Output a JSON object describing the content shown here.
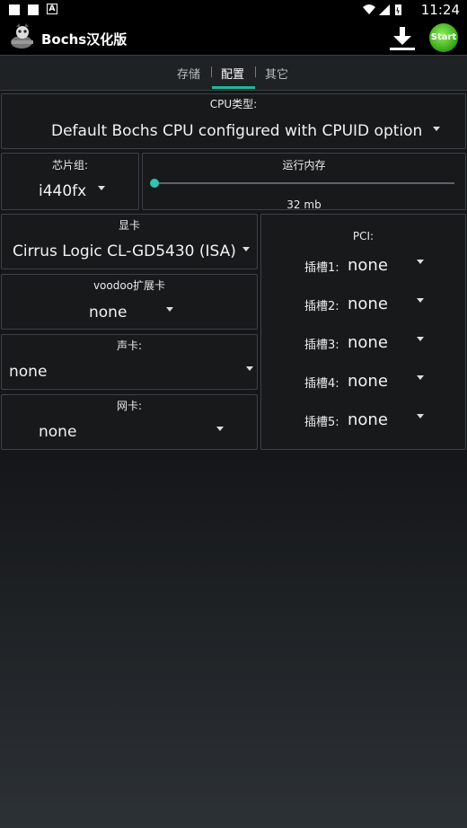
{
  "status_bar": {
    "time": "11:24"
  },
  "app": {
    "title": "Bochs汉化版",
    "start_label": "Start"
  },
  "tabs": [
    {
      "label": "存储"
    },
    {
      "label": "配置"
    },
    {
      "label": "其它"
    }
  ],
  "cpu": {
    "label": "CPU类型:",
    "value": "Default Bochs CPU configured with CPUID option"
  },
  "chipset": {
    "label": "芯片组:",
    "value": "i440fx"
  },
  "memory": {
    "label": "运行内存",
    "value": "32 mb"
  },
  "video": {
    "label": "显卡",
    "value": "Cirrus Logic CL-GD5430 (ISA)"
  },
  "voodoo": {
    "label": "voodoo扩展卡",
    "value": "none"
  },
  "sound": {
    "label": "声卡:",
    "value": "none"
  },
  "network": {
    "label": "网卡:",
    "value": "none"
  },
  "pci": {
    "label": "PCI:",
    "slots": [
      {
        "label": "插槽1:",
        "value": "none"
      },
      {
        "label": "插槽2:",
        "value": "none"
      },
      {
        "label": "插槽3:",
        "value": "none"
      },
      {
        "label": "插槽4:",
        "value": "none"
      },
      {
        "label": "插槽5:",
        "value": "none"
      }
    ]
  },
  "colors": {
    "accent": "#1fb59e",
    "start_green": "#3fbf1f"
  }
}
